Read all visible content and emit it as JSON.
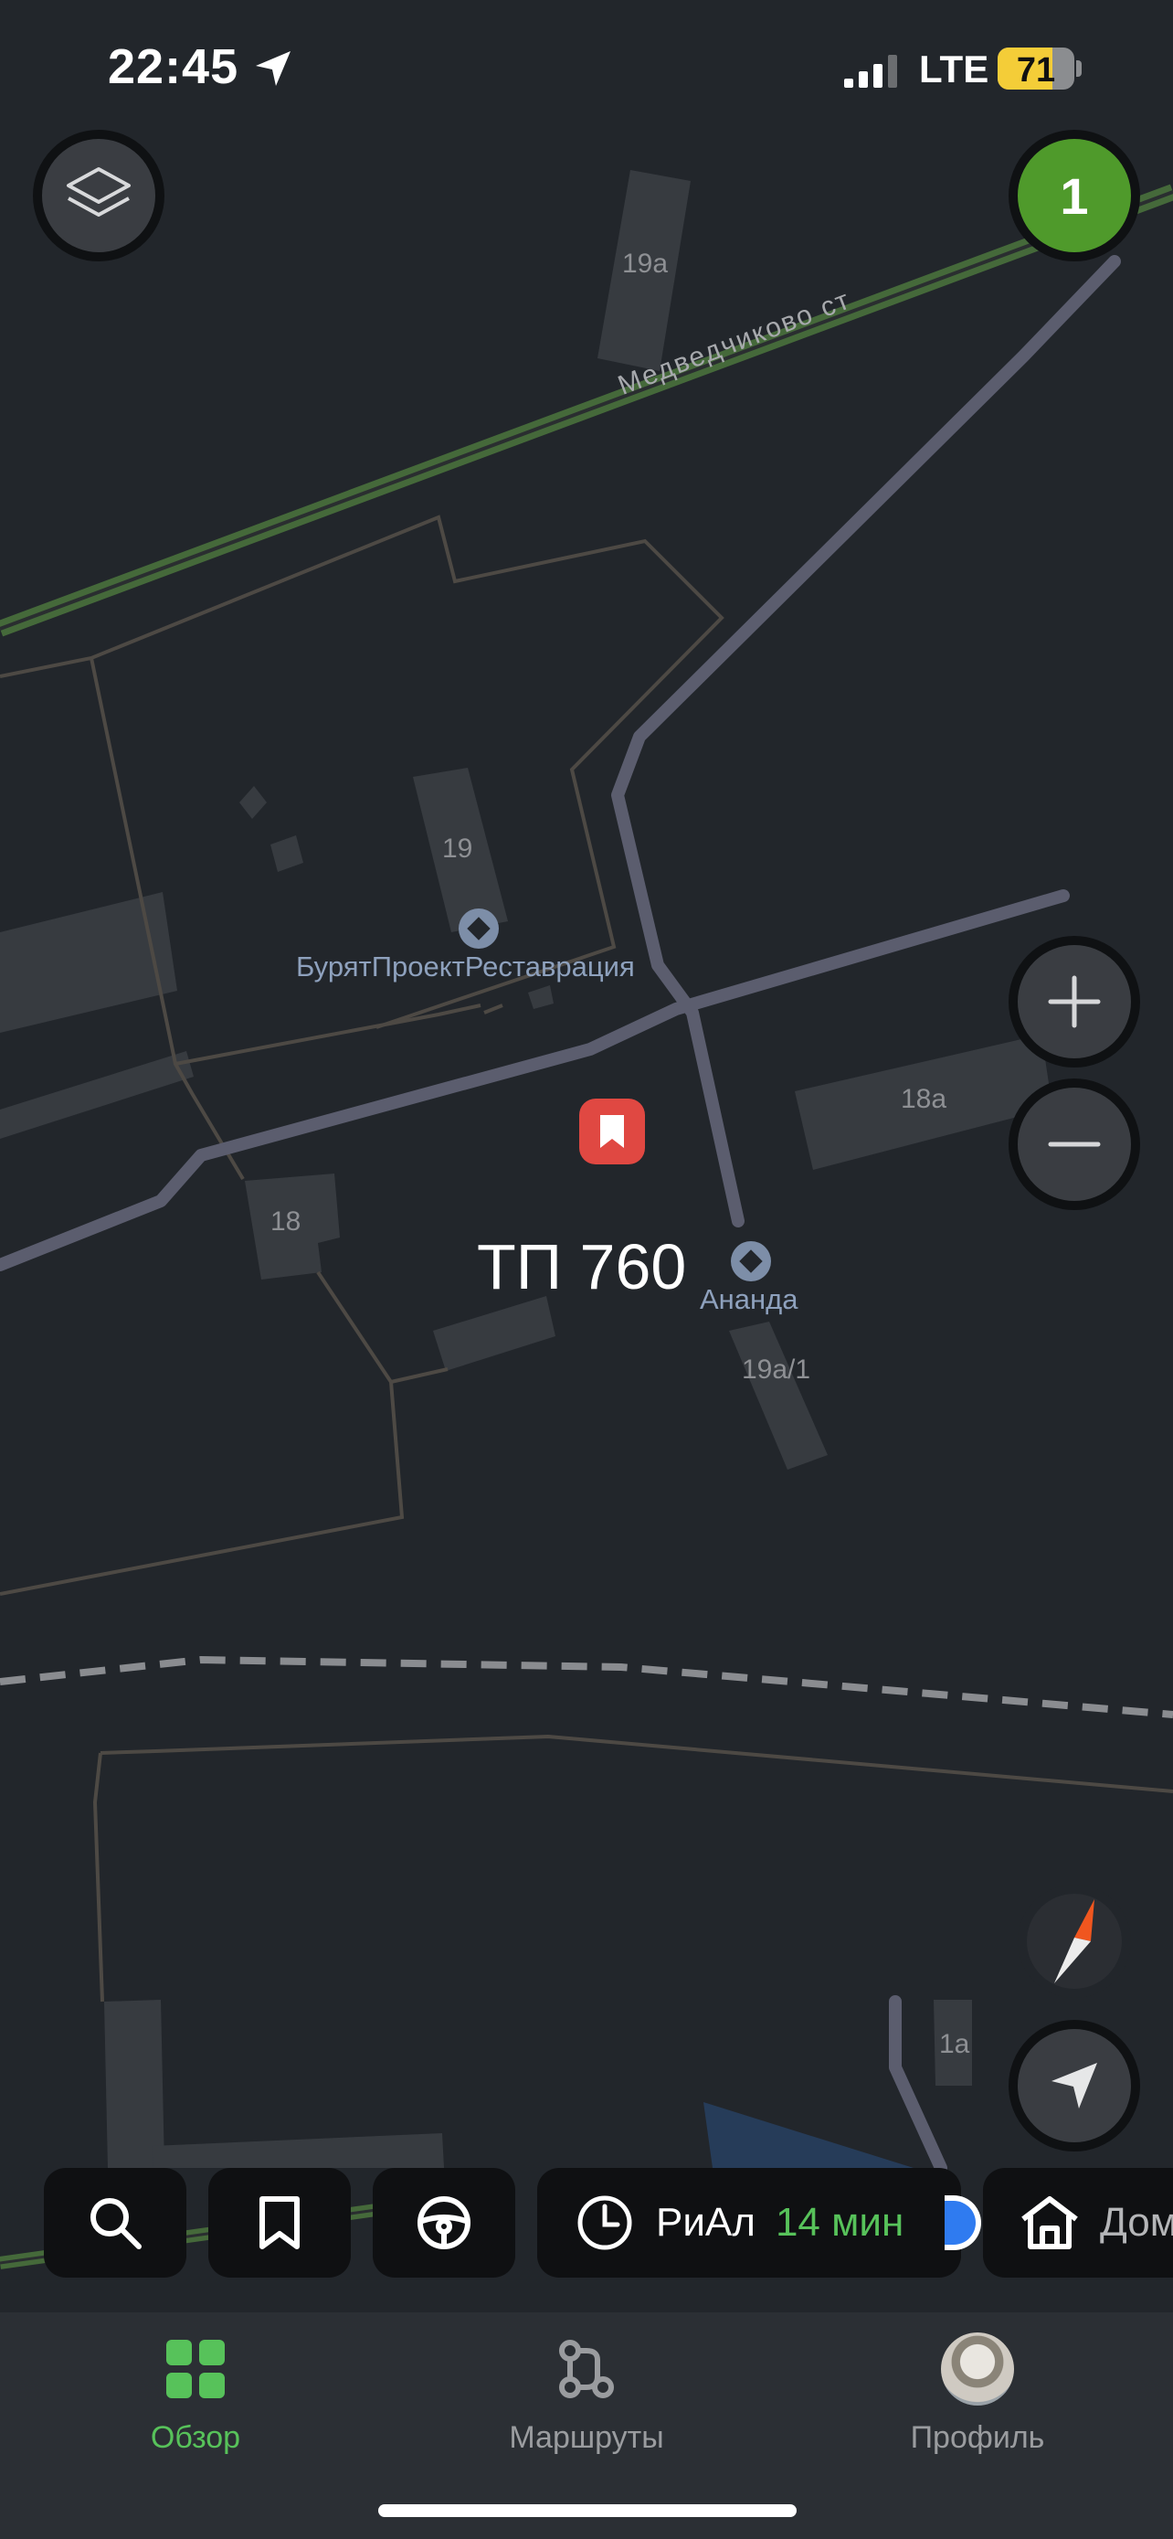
{
  "status_bar": {
    "time": "22:45",
    "carrier": "LTE",
    "battery": "71",
    "battery_level": 0.71
  },
  "map": {
    "badge_count": "1",
    "street_name": "Медведчиково ст",
    "buildings": [
      "19а",
      "19",
      "18а",
      "18",
      "19а/1",
      "1а"
    ],
    "pois": [
      "БурятПроектРеставрация",
      "Ананда"
    ],
    "place_title": "ТП 760"
  },
  "colors": {
    "accent_green": "#57c25a",
    "pin_red": "#e04842",
    "badge_green": "#4f9a2b",
    "road": "#5b5d6e",
    "rail_green": "#45693a"
  },
  "quick_actions": {
    "icons": [
      "search-icon",
      "bookmark-icon",
      "steering-wheel-icon"
    ],
    "recent_destination": {
      "name": "РиАл",
      "eta": "14 мин"
    },
    "home_label": "Дом"
  },
  "tabs": [
    {
      "label": "Обзор",
      "icon": "grid-icon",
      "active": true
    },
    {
      "label": "Маршруты",
      "icon": "routes-icon",
      "active": false
    },
    {
      "label": "Профиль",
      "icon": "avatar",
      "active": false
    }
  ]
}
